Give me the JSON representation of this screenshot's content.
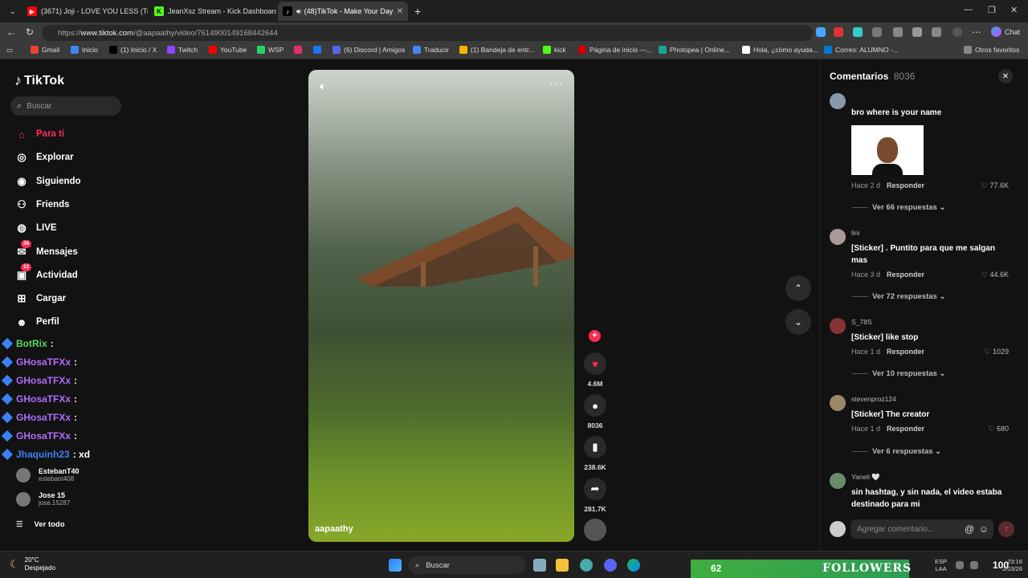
{
  "browser": {
    "tabs": [
      {
        "label": "(3671) Joji - LOVE YOU LESS (Trad",
        "icon": "youtube-icon",
        "color": "#ff0000"
      },
      {
        "label": "JeanXsz Stream - Kick Dashboard",
        "icon": "kick-icon",
        "color": "#53fc18"
      },
      {
        "label": "(48)TikTok - Make Your Day",
        "icon": "tiktok-icon",
        "color": "#000000"
      }
    ],
    "url_prefix": "https://",
    "url_host": "www.tiktok.com",
    "url_path": "/@aapaathy/video/7614900149168442644",
    "profile_label": "Chat",
    "bookmarks": [
      {
        "label": "Gmail",
        "icon": "gmail-icon",
        "color": "#ea4335"
      },
      {
        "label": "Inicio",
        "icon": "home-icon",
        "color": "#4285f4"
      },
      {
        "label": "(1) Inicio / X",
        "icon": "x-icon",
        "color": "#000000"
      },
      {
        "label": "Twitch",
        "icon": "twitch-icon",
        "color": "#9146ff"
      },
      {
        "label": "YouTube",
        "icon": "youtube-icon",
        "color": "#ff0000"
      },
      {
        "label": "WSP",
        "icon": "whatsapp-icon",
        "color": "#25d366"
      },
      {
        "label": "",
        "icon": "instagram-icon",
        "color": "#e1306c"
      },
      {
        "label": "",
        "icon": "facebook-icon",
        "color": "#1877f2"
      },
      {
        "label": "(6) Discord | Amigos",
        "icon": "discord-icon",
        "color": "#5865f2"
      },
      {
        "label": "Traducir",
        "icon": "translate-icon",
        "color": "#4285f4"
      },
      {
        "label": "(1) Bandeja de entr...",
        "icon": "mail-icon",
        "color": "#f4b400"
      },
      {
        "label": "kick",
        "icon": "kick-icon",
        "color": "#53fc18"
      },
      {
        "label": "Página de inicio —...",
        "icon": "page-icon",
        "color": "#cc0000"
      },
      {
        "label": "Photopea | Online...",
        "icon": "photopea-icon",
        "color": "#18a497"
      },
      {
        "label": "Hola, ¿cómo ayuda...",
        "icon": "chatgpt-icon",
        "color": "#ffffff"
      },
      {
        "label": "Correo: ALUMNO -...",
        "icon": "outlook-icon",
        "color": "#0078d4"
      }
    ],
    "other_bookmarks": "Otros favoritos"
  },
  "sidebar": {
    "logo": "TikTok",
    "search_placeholder": "Buscar",
    "nav": [
      {
        "label": "Para ti",
        "icon": "home-icon",
        "active": true
      },
      {
        "label": "Explorar",
        "icon": "compass-icon"
      },
      {
        "label": "Siguiendo",
        "icon": "following-icon"
      },
      {
        "label": "Friends",
        "icon": "friends-icon"
      },
      {
        "label": "LIVE",
        "icon": "live-icon"
      },
      {
        "label": "Mensajes",
        "icon": "messages-icon",
        "badge": "36"
      },
      {
        "label": "Actividad",
        "icon": "activity-icon",
        "badge": "12"
      },
      {
        "label": "Cargar",
        "icon": "upload-icon"
      },
      {
        "label": "Perfil",
        "icon": "profile-icon"
      }
    ],
    "following": [
      {
        "name": "EstebanT40",
        "handle": "estebant408"
      },
      {
        "name": "Jose 15",
        "handle": "jose.15287"
      }
    ],
    "see_all": "Ver todo"
  },
  "chat_overlay": [
    {
      "user": "BotRix",
      "message": ":",
      "color": "#5bd65b"
    },
    {
      "user": "GHosaTFXx",
      "message": ":",
      "color": "#b36bff"
    },
    {
      "user": "GHosaTFXx",
      "message": ":",
      "color": "#b36bff"
    },
    {
      "user": "GHosaTFXx",
      "message": ":",
      "color": "#b36bff"
    },
    {
      "user": "GHosaTFXx",
      "message": ":",
      "color": "#b36bff"
    },
    {
      "user": "GHosaTFXx",
      "message": ":",
      "color": "#b36bff"
    },
    {
      "user": "Jhaquinh23",
      "message": ": xd",
      "color": "#3b82f6"
    }
  ],
  "video": {
    "author": "aapaathy",
    "actions": [
      {
        "icon": "heart-icon",
        "count": "4.6M",
        "color": "#fe2c55"
      },
      {
        "icon": "comment-icon",
        "count": "8036"
      },
      {
        "icon": "bookmark-icon",
        "count": "238.6K"
      },
      {
        "icon": "share-icon",
        "count": "281.7K"
      }
    ]
  },
  "comments": {
    "title": "Comentarios",
    "count": "8036",
    "reply_label": "Responder",
    "items": [
      {
        "user": "",
        "text": "bro where is your name",
        "time": "Hace 2 d",
        "likes": "77.6K",
        "replies": "Ver 66 respuestas",
        "has_sticker": true
      },
      {
        "user": "lini",
        "text": "[Sticker] . Puntito para que me salgan mas",
        "time": "Hace 3 d",
        "likes": "44.6K",
        "replies": "Ver 72 respuestas"
      },
      {
        "user": "S_78S",
        "text": "[Sticker] like stop",
        "time": "Hace 1 d",
        "likes": "1029",
        "replies": "Ver 10 respuestas"
      },
      {
        "user": "stevenproz124",
        "text": "[Sticker] The creator",
        "time": "Hace 1 d",
        "likes": "680",
        "replies": "Ver 6 respuestas"
      },
      {
        "user": "Yaneli 🤍",
        "text": "sin hashtag, y sin nada, el video estaba destinado para mi",
        "time": "",
        "likes": "",
        "replies": ""
      }
    ],
    "input_placeholder": "Agregar comentario..."
  },
  "taskbar": {
    "weather_temp": "20°C",
    "weather_desc": "Despejado",
    "search_label": "Buscar",
    "followers_count": "62",
    "followers_label": "FOLLOWERS",
    "lang": "ESP",
    "lang_sub": "LAA",
    "time": "23:16",
    "date": "2/03/26",
    "overlay_number": "100"
  }
}
